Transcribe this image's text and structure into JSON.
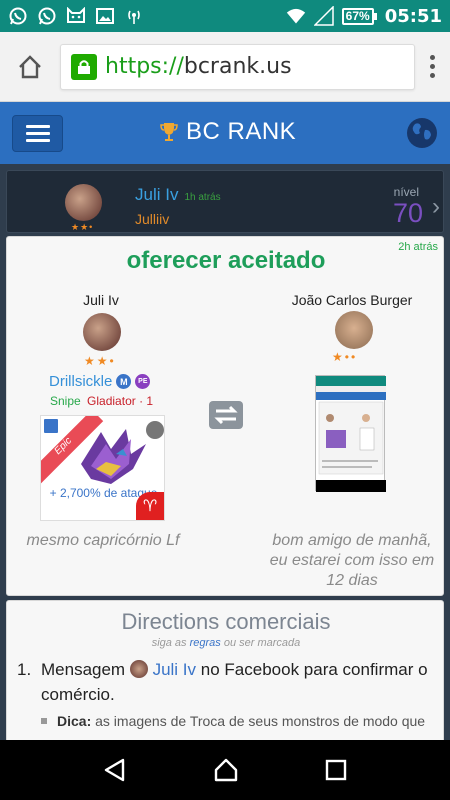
{
  "status_bar": {
    "battery": "67%",
    "time": "05:51",
    "icons": [
      "whatsapp-icon",
      "whatsapp-icon",
      "cat-icon",
      "image-icon",
      "hotspot-icon"
    ],
    "right_icons": [
      "wifi-icon",
      "signal-icon"
    ]
  },
  "browser": {
    "url_scheme": "https://",
    "url_host": "bcrank.us"
  },
  "navbar": {
    "brand": "BC RANK",
    "trophy_color": "#f0a830"
  },
  "user": {
    "name": "Juli Iv",
    "time_ago": "1h atrás",
    "handle": "Julliiv",
    "stars": "★★•",
    "level_label": "nível",
    "level": "70"
  },
  "trade": {
    "time_ago": "2h atrás",
    "title": "oferecer aceitado",
    "left": {
      "name": "Juli Iv",
      "stars": "★★•",
      "monster": "Drillsickle",
      "badge1": "M",
      "badge2": "PE",
      "role1": "Snipe",
      "role2": "Gladiator · 1",
      "rarity": "Epic",
      "bonus": "+ 2,700% de ataque",
      "caption": "mesmo capricórnio Lf"
    },
    "right": {
      "name": "João Carlos Burger",
      "stars": "★••",
      "caption": "bom amigo de manhã, eu estarei com isso em 12 dias"
    }
  },
  "directions": {
    "title": "Directions comerciais",
    "sub_prefix": "siga as",
    "sub_link": "regras",
    "sub_suffix": "ou ser marcada",
    "step_num": "1.",
    "step_pre": "Mensagem",
    "step_link": "Juli Iv",
    "step_post": "no Facebook para confirmar o comércio.",
    "tip_label": "Dica:",
    "tip_text": "as imagens de Troca de seus monstros de modo que"
  }
}
